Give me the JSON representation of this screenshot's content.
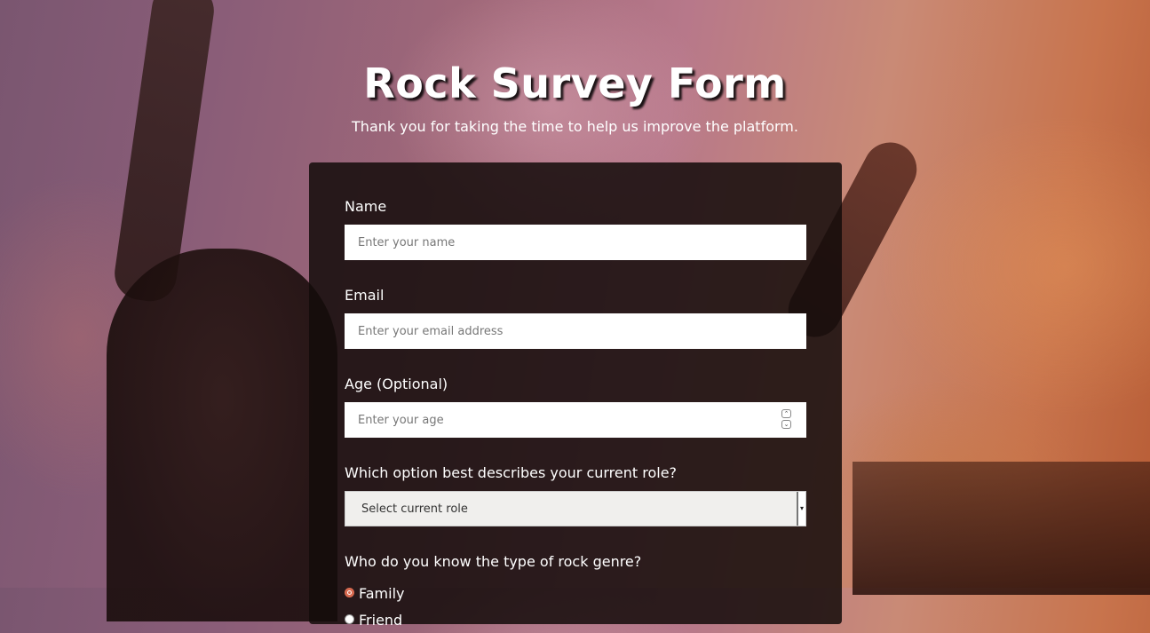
{
  "header": {
    "title": "Rock Survey Form",
    "description": "Thank you for taking the time to help us improve the platform."
  },
  "form": {
    "name": {
      "label": "Name",
      "placeholder": "Enter your name"
    },
    "email": {
      "label": "Email",
      "placeholder": "Enter your email address"
    },
    "age": {
      "label": "Age (Optional)",
      "placeholder": "Enter your age"
    },
    "role": {
      "label": "Which option best describes your current role?",
      "selected": "Select current role"
    },
    "genre": {
      "question": "Who do you know the type of rock genre?",
      "options": [
        {
          "label": "Family",
          "checked": true
        },
        {
          "label": "Friend",
          "checked": false
        }
      ]
    }
  },
  "colors": {
    "accent": "#d86a50",
    "card_bg": "#140c0a"
  },
  "icons": {
    "spinner_up": "chevron-up-icon",
    "spinner_down": "chevron-down-icon",
    "select": "caret-down-icon"
  }
}
